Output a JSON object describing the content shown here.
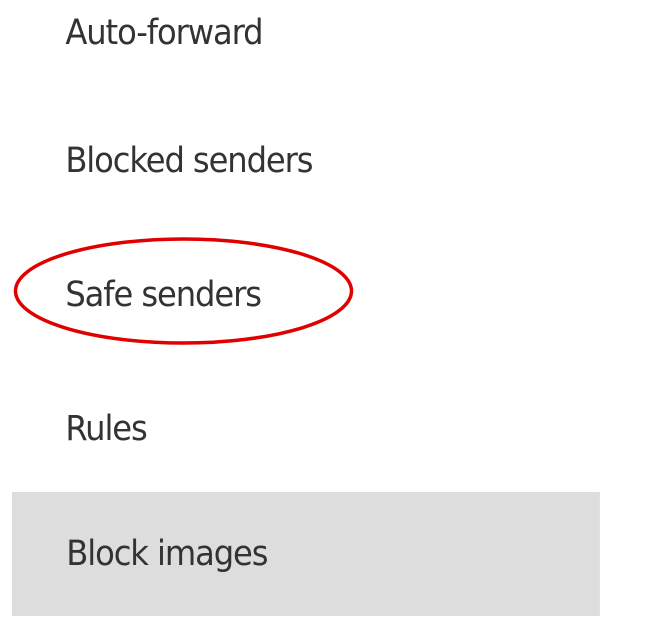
{
  "settings_menu": {
    "items": [
      {
        "label": "Auto-forward"
      },
      {
        "label": "Blocked senders"
      },
      {
        "label": "Safe senders"
      },
      {
        "label": "Rules"
      },
      {
        "label": "Block images"
      }
    ],
    "selected_item": "Block images"
  },
  "annotation": {
    "highlighted_item": "Safe senders",
    "color": "#e00000"
  },
  "colors": {
    "text": "#333333",
    "selected_background": "#dddddd"
  }
}
